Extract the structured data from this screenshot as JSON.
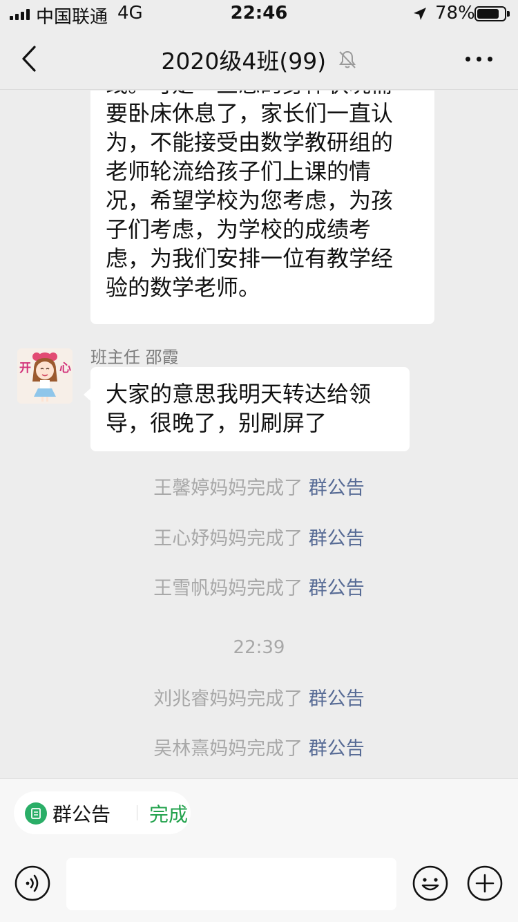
{
  "status_bar": {
    "carrier": "中国联通",
    "network": "4G",
    "time": "22:46",
    "battery": "78%"
  },
  "nav": {
    "title": "2020级4班(99)",
    "icons": [
      "back-icon",
      "mute-bell-icon",
      "more-icon"
    ]
  },
  "messages": [
    {
      "type": "text",
      "lines": [
        "线。可是一旦您的身体状况需",
        "要卧床休息了，家长们一直认",
        "为，不能接受由数学教研组的",
        "老师轮流给孩子们上课的情",
        "况，希望学校为您考虑，为孩",
        "子们考虑，为学校的成绩考",
        "虑，为我们安排一位有教学经",
        "验的数学老师。"
      ]
    },
    {
      "type": "text",
      "sender": "班主任 邵霞",
      "avatar_text": [
        "开",
        "心"
      ],
      "lines": [
        "大家的意思我明天转达给领",
        "导，很晚了，别刷屏了"
      ]
    }
  ],
  "system_messages": [
    {
      "text": "王馨婷妈妈完成了",
      "link": "群公告"
    },
    {
      "text": "王心妤妈妈完成了",
      "link": "群公告"
    },
    {
      "text": "王雪帆妈妈完成了",
      "link": "群公告"
    },
    {
      "text": "刘兆睿妈妈完成了",
      "link": "群公告"
    },
    {
      "text": "吴林熹妈妈完成了",
      "link": "群公告"
    }
  ],
  "timestamp": "22:39",
  "announcement_bar": {
    "label": "群公告",
    "action": "完成"
  },
  "input": {
    "value": "",
    "placeholder": ""
  },
  "colors": {
    "background": "#ededed",
    "link": "#576b95",
    "accent_green": "#22a24c"
  }
}
